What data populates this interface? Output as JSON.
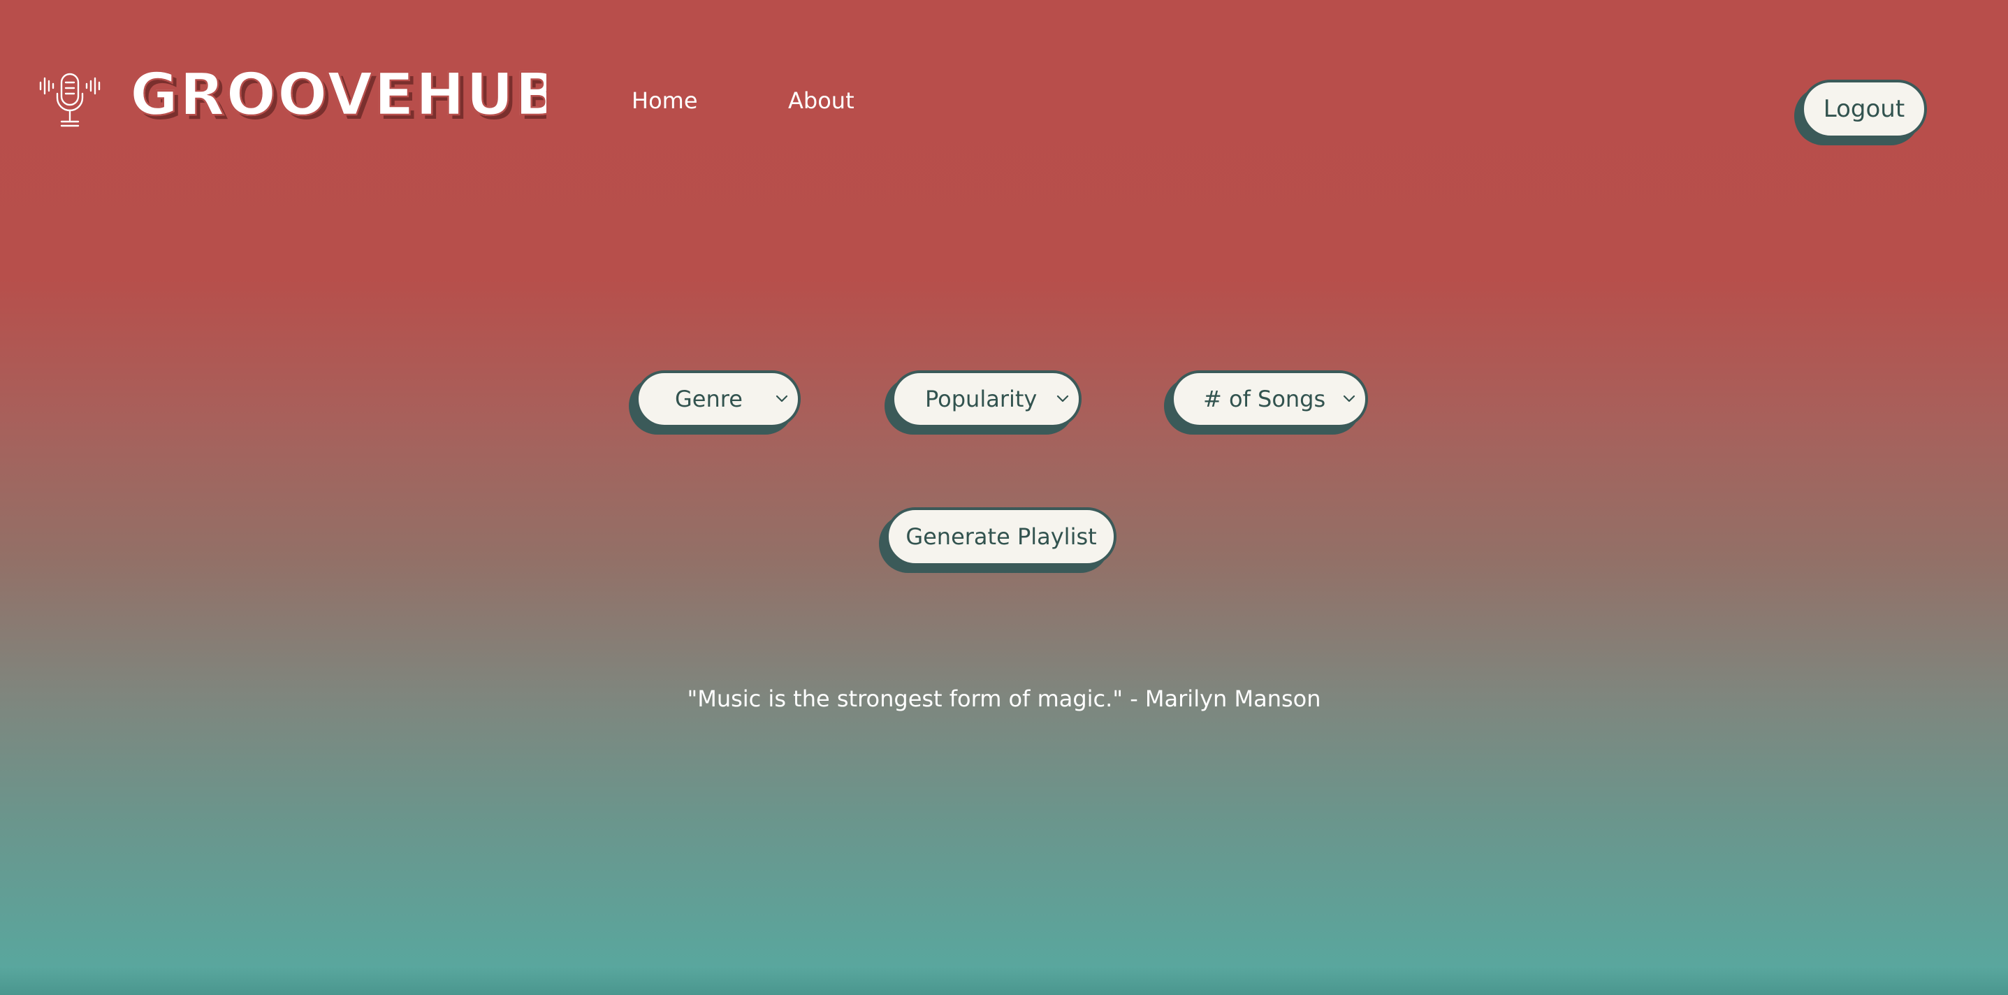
{
  "header": {
    "brand": "GROOVEHUB",
    "logo_icon": "microphone-icon",
    "nav": [
      {
        "label": "Home"
      },
      {
        "label": "About"
      }
    ],
    "logout_label": "Logout"
  },
  "filters": {
    "genre": {
      "label": "Genre",
      "icon": "chevron-down-icon"
    },
    "popularity": {
      "label": "Popularity",
      "icon": "chevron-down-icon"
    },
    "songs": {
      "label": "# of Songs",
      "icon": "chevron-down-icon"
    }
  },
  "actions": {
    "generate_label": "Generate Playlist"
  },
  "quote": "\"Music is the strongest form of magic.\" - Marilyn Manson",
  "colors": {
    "gradient_top": "#b84e4b",
    "gradient_bottom": "#56aaa1",
    "pill_fill": "#f6f4ee",
    "pill_border": "#3b5a59",
    "pill_text": "#32534f",
    "white": "#ffffff"
  }
}
